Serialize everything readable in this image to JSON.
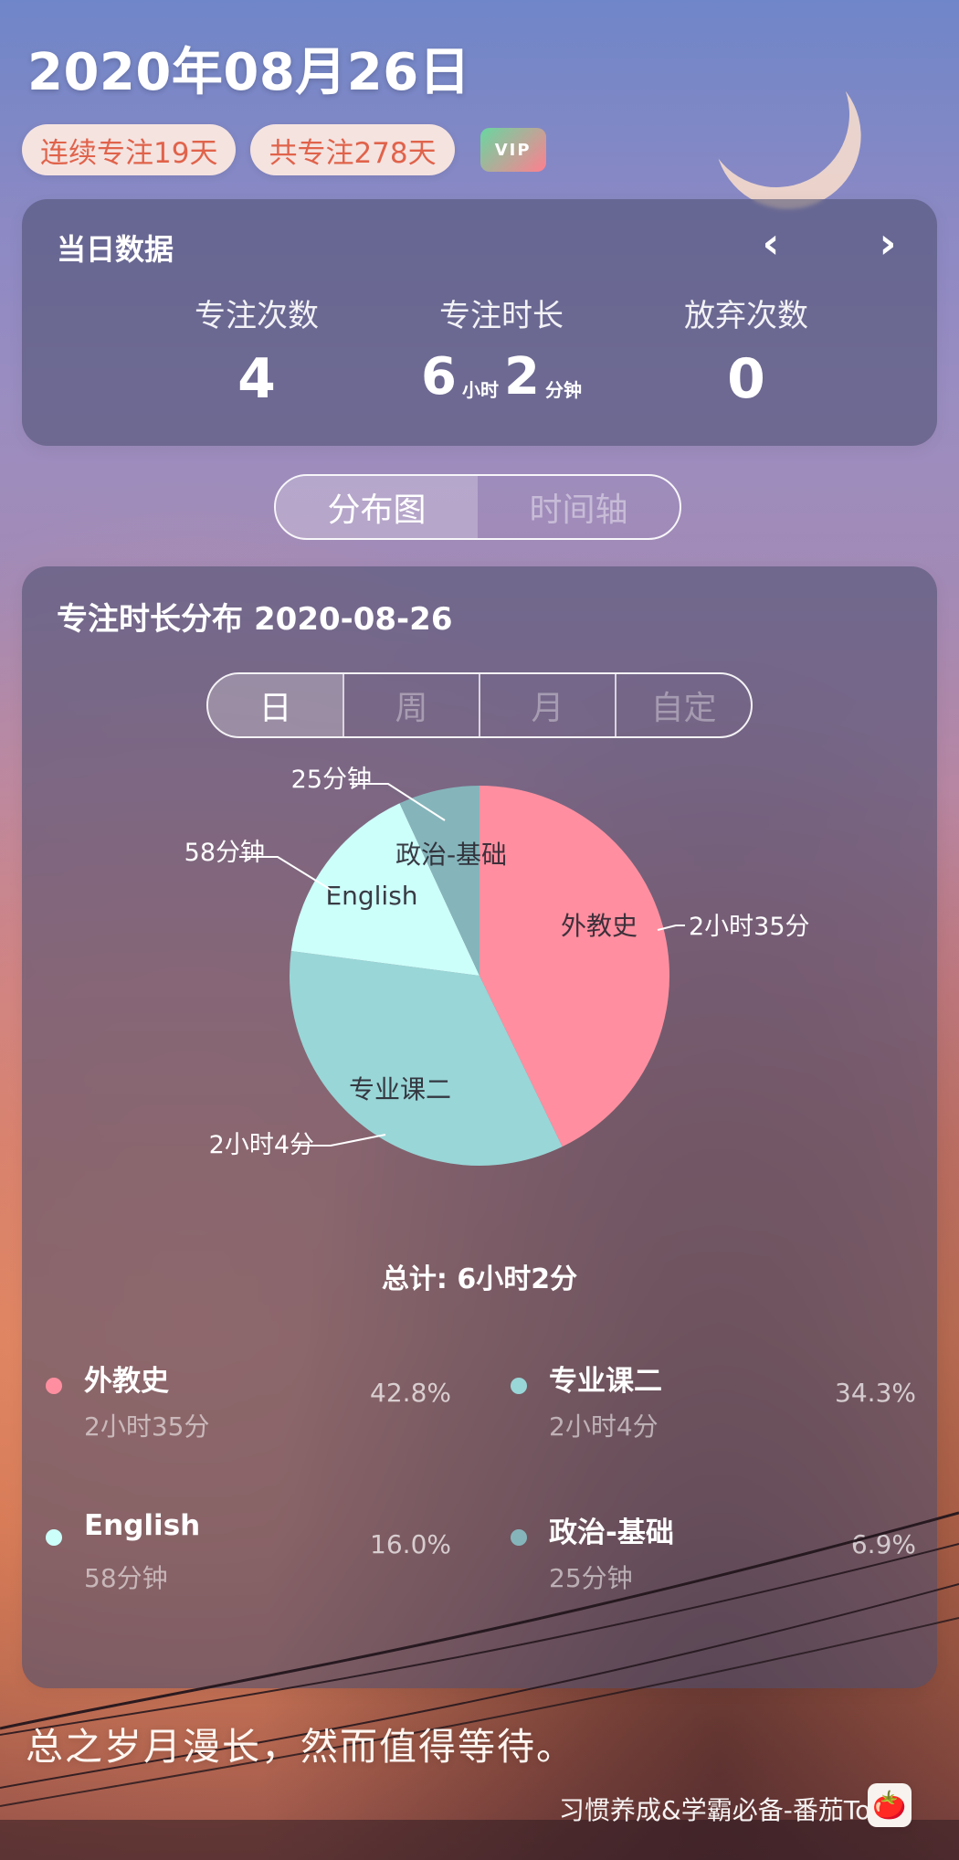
{
  "header": {
    "date_title": "2020年08月26日",
    "badges": [
      {
        "label": "连续专注19天"
      },
      {
        "label": "共专注278天"
      }
    ],
    "vip_label": "VIP"
  },
  "daily_data": {
    "title": "当日数据",
    "prev_symbol": "‹",
    "next_symbol": "›",
    "stats": {
      "focus_count": {
        "label": "专注次数",
        "value": "4"
      },
      "focus_duration": {
        "label": "专注时长",
        "hours_value": "6",
        "hours_unit": "小时",
        "minutes_value": "2",
        "minutes_unit": "分钟"
      },
      "abandon_count": {
        "label": "放弃次数",
        "value": "0"
      }
    }
  },
  "view_switcher": {
    "tabs": [
      {
        "label": "分布图",
        "active": true
      },
      {
        "label": "时间轴",
        "active": false
      }
    ]
  },
  "distribution": {
    "title": "专注时长分布",
    "date": "2020-08-26",
    "period_tabs": [
      {
        "label": "日",
        "active": true
      },
      {
        "label": "周",
        "active": false
      },
      {
        "label": "月",
        "active": false
      },
      {
        "label": "自定",
        "active": false
      }
    ],
    "total_label": "总计: 6小时2分",
    "chart_data": {
      "type": "pie",
      "slices": [
        {
          "name": "外教史",
          "label": "2小时35分",
          "value": 155,
          "percent": 42.8,
          "color": "#ff8fa0"
        },
        {
          "name": "专业课二",
          "label": "2小时4分",
          "value": 124,
          "percent": 34.3,
          "color": "#99d6d7"
        },
        {
          "name": "English",
          "label": "58分钟",
          "value": 58,
          "percent": 16.0,
          "color": "#ccfffa"
        },
        {
          "name": "政治-基础",
          "label": "25分钟",
          "value": 25,
          "percent": 6.9,
          "color": "#85b5bb"
        }
      ]
    },
    "legend": [
      {
        "name": "外教史",
        "duration": "2小时35分",
        "percent": "42.8%",
        "color": "#ff8fa0"
      },
      {
        "name": "专业课二",
        "duration": "2小时4分",
        "percent": "34.3%",
        "color": "#99d6d7"
      },
      {
        "name": "English",
        "duration": "58分钟",
        "percent": "16.0%",
        "color": "#ccfffa"
      },
      {
        "name": "政治-基础",
        "duration": "25分钟",
        "percent": "6.9%",
        "color": "#85b5bb"
      }
    ]
  },
  "footer": {
    "quote": "总之岁月漫长，然而值得等待。",
    "app_slogan": "习惯养成&学霸必备-番茄ToDo",
    "app_icon": "🍅"
  }
}
